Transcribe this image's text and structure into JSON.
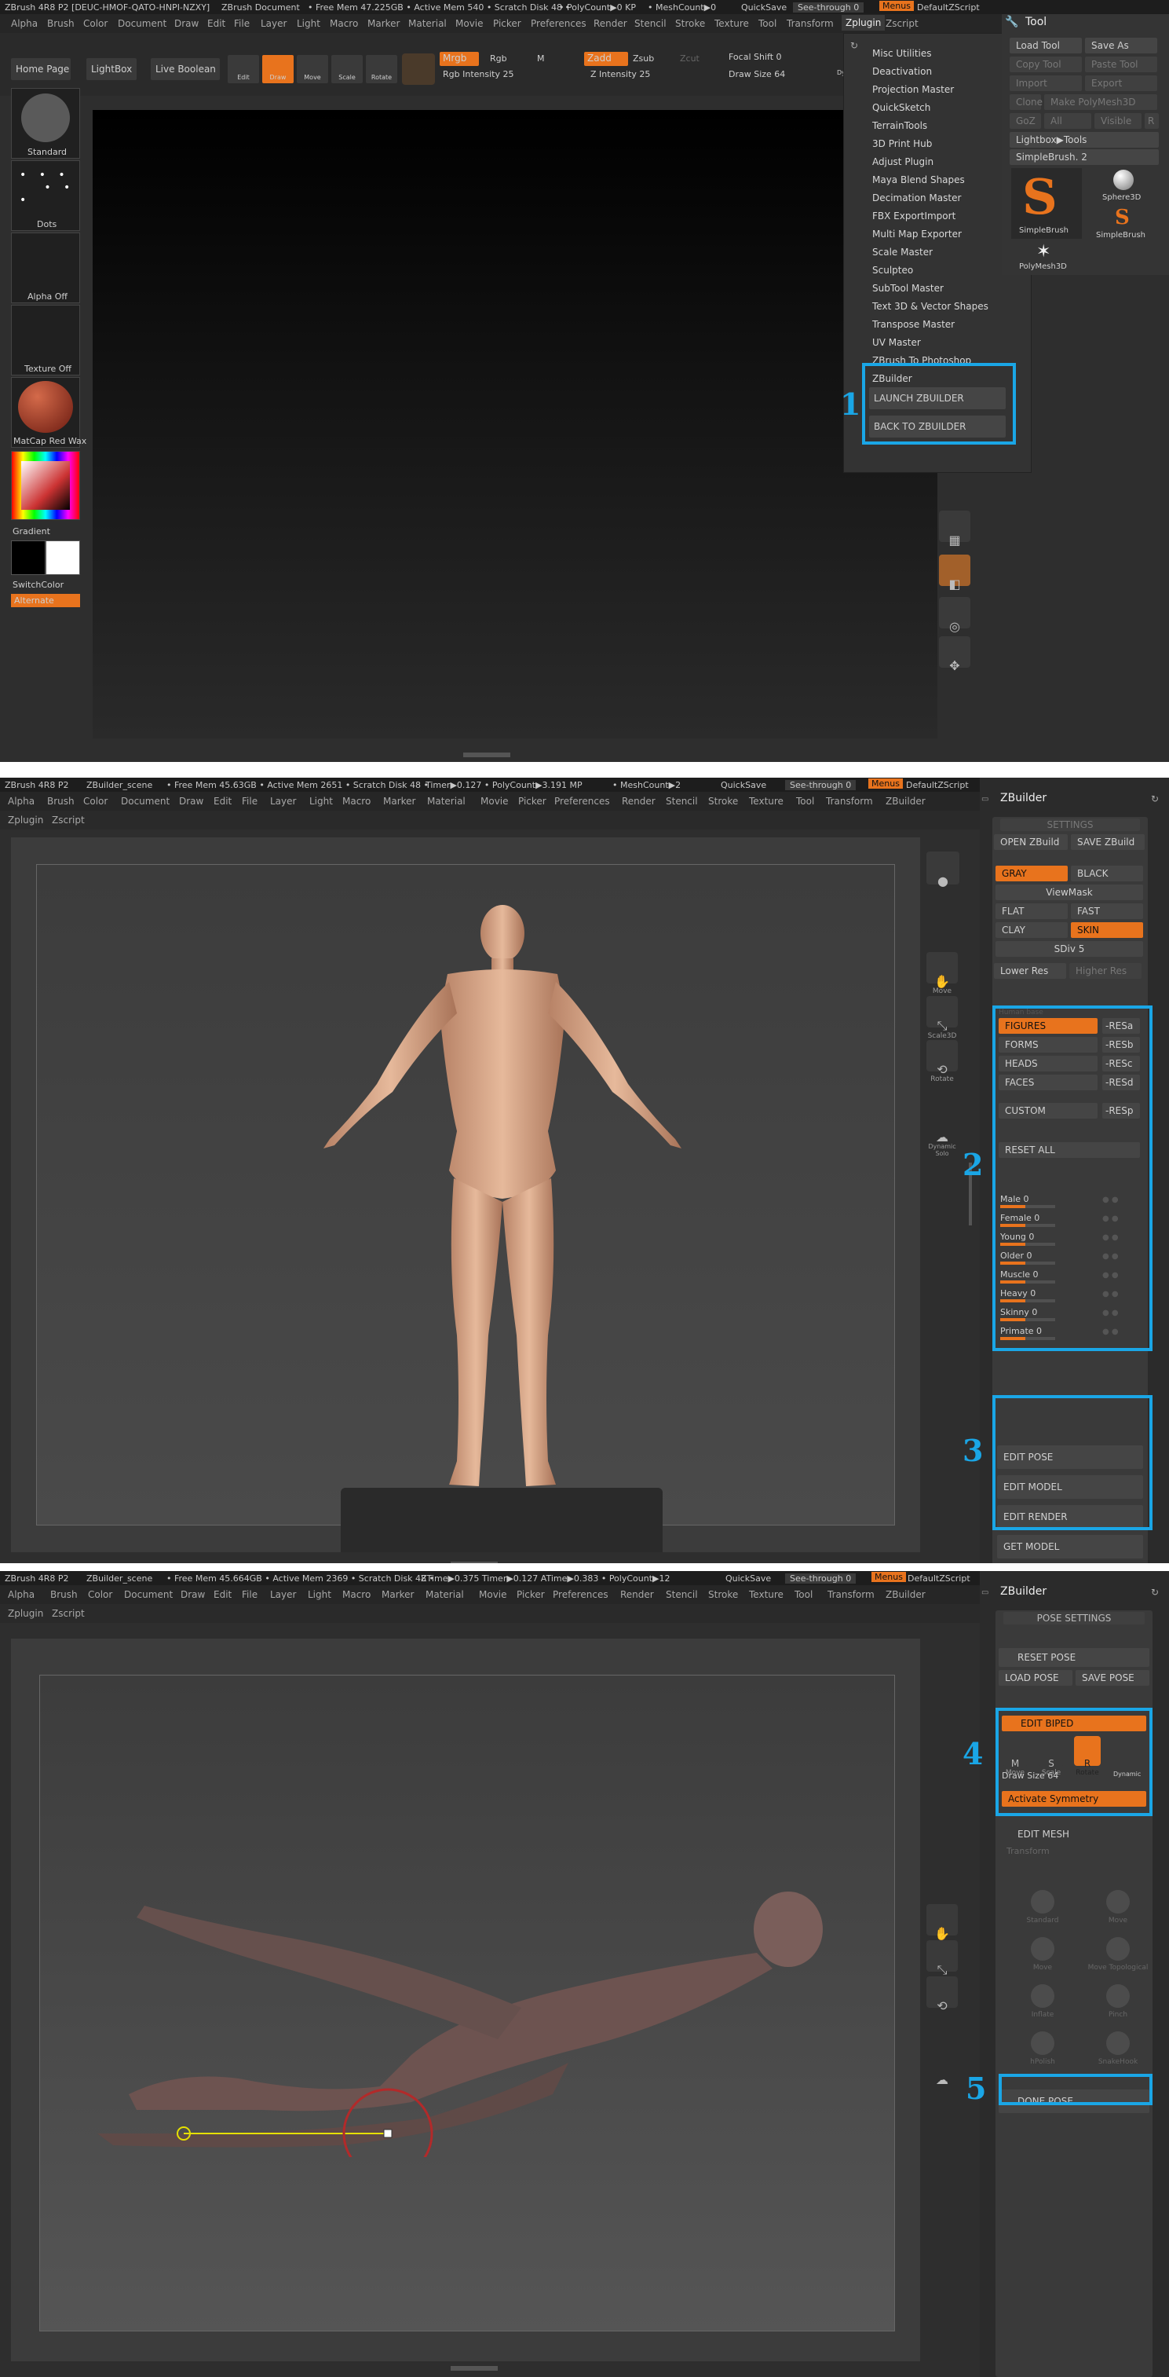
{
  "panel1": {
    "topbar": {
      "title": "ZBrush 4R8 P2 [DEUC-HMOF-QATO-HNPI-NZXY]",
      "doc": "ZBrush Document",
      "stats": "• Free Mem 47.225GB • Active Mem 540 • Scratch Disk 48 •",
      "poly": "• PolyCount▶0 KP",
      "mesh": "• MeshCount▶0",
      "quicksave": "QuickSave",
      "seethrough": "See-through  0",
      "menus": "Menus",
      "script": "DefaultZScript"
    },
    "menus": [
      "Alpha",
      "Brush",
      "Color",
      "Document",
      "Draw",
      "Edit",
      "File",
      "Layer",
      "Light",
      "Macro",
      "Marker",
      "Material",
      "Movie",
      "Picker",
      "Preferences",
      "Render",
      "Stencil",
      "Stroke",
      "Texture",
      "Tool",
      "Transform",
      "Zplugin",
      "Zscript"
    ],
    "toolbar": {
      "home": "Home Page",
      "lightbox": "LightBox",
      "liveboolean": "Live Boolean",
      "edit": "Edit",
      "draw": "Draw",
      "move": "Move",
      "scale": "Scale",
      "rotate": "Rotate",
      "mrgb": "Mrgb",
      "rgb": "Rgb",
      "m": "M",
      "zadd": "Zadd",
      "zsub": "Zsub",
      "zcut": "Zcut",
      "rgbint": "Rgb Intensity 25",
      "zint": "Z Intensity 25",
      "focal": "Focal Shift 0",
      "drawsize": "Draw Size 64",
      "dynamic": "Dynamic"
    },
    "left": {
      "standard": "Standard",
      "dots": "Dots",
      "alpha": "Alpha Off",
      "texture": "Texture Off",
      "matcap": "MatCap Red Wax",
      "gradient": "Gradient",
      "switch": "SwitchColor",
      "alternate": "Alternate"
    },
    "dropdown": {
      "items": [
        "Misc Utilities",
        "Deactivation",
        "Projection Master",
        "QuickSketch",
        "TerrainTools",
        "3D Print Hub",
        "Adjust Plugin",
        "Maya Blend Shapes",
        "Decimation Master",
        "FBX ExportImport",
        "Multi Map Exporter",
        "Scale Master",
        "Sculpteo",
        "SubTool Master",
        "Text 3D & Vector Shapes",
        "Transpose Master",
        "UV Master",
        "ZBrush To Photoshop"
      ],
      "zbuilder": "ZBuilder",
      "launch": "LAUNCH ZBUILDER",
      "back": "BACK TO ZBUILDER"
    },
    "tool": {
      "title": "Tool",
      "load": "Load Tool",
      "saveas": "Save As",
      "copy": "Copy Tool",
      "paste": "Paste Tool",
      "import": "Import",
      "export": "Export",
      "clone": "Clone",
      "make": "Make PolyMesh3D",
      "goz": "GoZ",
      "all": "All",
      "visible": "Visible",
      "r": "R",
      "lightboxtools": "Lightbox▶Tools",
      "simplebrush": "SimpleBrush. 2",
      "sphere": "Sphere3D",
      "sb1": "SimpleBrush",
      "sb2": "SimpleBrush",
      "polymesh": "PolyMesh3D"
    },
    "callout": "1"
  },
  "panel2": {
    "topbar": {
      "title": "ZBrush 4R8 P2",
      "doc": "ZBuilder_scene",
      "stats": "• Free Mem 45.63GB • Active Mem 2651 • Scratch Disk 48 •",
      "timer": "Timer▶0.127 • PolyCount▶3.191 MP",
      "mesh": "• MeshCount▶2",
      "quicksave": "QuickSave",
      "seethrough": "See-through  0",
      "menus": "Menus",
      "script": "DefaultZScript"
    },
    "menus": [
      "Alpha",
      "Brush",
      "Color",
      "Document",
      "Draw",
      "Edit",
      "File",
      "Layer",
      "Light",
      "Macro",
      "Marker",
      "Material",
      "Movie",
      "Picker",
      "Preferences",
      "Render",
      "Stencil",
      "Stroke",
      "Texture",
      "Tool",
      "Transform",
      "ZBuilder"
    ],
    "menus2": [
      "Zplugin",
      "Zscript"
    ],
    "panel_title": "ZBuilder",
    "settings": "SETTINGS",
    "open": "OPEN ZBuild",
    "save": "SAVE ZBuild",
    "gray": "GRAY",
    "black": "BLACK",
    "viewmask": "ViewMask",
    "flat": "FLAT",
    "fast": "FAST",
    "clay": "CLAY",
    "skin": "SKIN",
    "sdiv": "SDiv 5",
    "lower": "Lower Res",
    "higher": "Higher Res",
    "humanbase": "Human base",
    "figures": "FIGURES",
    "forms": "FORMS",
    "heads": "HEADS",
    "faces": "FACES",
    "custom": "CUSTOM",
    "resa": "-RESa",
    "resb": "-RESb",
    "resc": "-RESc",
    "resd": "-RESd",
    "resp": "-RESp",
    "resetall": "RESET ALL",
    "morphs": [
      {
        "label": "Male 0",
        "value": 0.45
      },
      {
        "label": "Female 0",
        "value": 0.45
      },
      {
        "label": "Young 0",
        "value": 0.45
      },
      {
        "label": "Older 0",
        "value": 0.45
      },
      {
        "label": "Muscle 0",
        "value": 0.45
      },
      {
        "label": "Heavy 0",
        "value": 0.45
      },
      {
        "label": "Skinny 0",
        "value": 0.45
      },
      {
        "label": "Primate 0",
        "value": 0.45
      }
    ],
    "editpose": "EDIT POSE",
    "editmodel": "EDIT MODEL",
    "editrender": "EDIT RENDER",
    "getmodel": "GET MODEL",
    "callout2": "2",
    "callout3": "3",
    "side": [
      "Move",
      "Scale3D",
      "Rotate",
      "Dynamic Solo"
    ]
  },
  "panel3": {
    "topbar": {
      "title": "ZBrush 4R8 P2",
      "doc": "ZBuilder_scene",
      "stats": "• Free Mem 45.664GB • Active Mem 2369 • Scratch Disk 48 •",
      "timer": "ZTime▶0.375 Timer▶0.127 ATime▶0.383 • PolyCount▶12",
      "quicksave": "QuickSave",
      "seethrough": "See-through  0",
      "menus": "Menus",
      "script": "DefaultZScript"
    },
    "menus": [
      "Alpha",
      "Brush",
      "Color",
      "Document",
      "Draw",
      "Edit",
      "File",
      "Layer",
      "Light",
      "Macro",
      "Marker",
      "Material",
      "Movie",
      "Picker",
      "Preferences",
      "Render",
      "Stencil",
      "Stroke",
      "Texture",
      "Tool",
      "Transform",
      "ZBuilder"
    ],
    "menus2": [
      "Zplugin",
      "Zscript"
    ],
    "panel_title": "ZBuilder",
    "posesettings": "POSE SETTINGS",
    "reset": "RESET POSE",
    "load": "LOAD POSE",
    "save": "SAVE POSE",
    "editbiped": "EDIT BIPED",
    "move": "Move",
    "scale": "Scale",
    "rotate": "Rotate",
    "drawsize": "Draw Size 64",
    "dynamic": "Dynamic",
    "symmetry": "Activate Symmetry",
    "editmesh": "EDIT MESH",
    "transform": "Transform",
    "brushes": [
      "Standard",
      "Move",
      "Move",
      "Move Topological",
      "Inflate",
      "Pinch",
      "hPolish",
      "SnakeHook"
    ],
    "donepose": "DONE POSE",
    "callout4": "4",
    "callout5": "5"
  }
}
